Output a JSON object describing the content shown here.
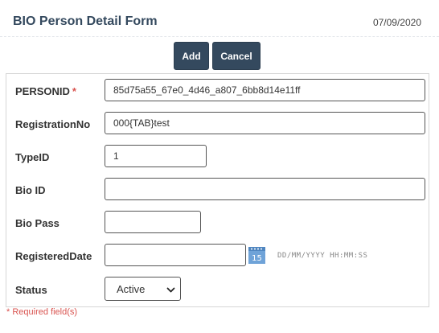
{
  "header": {
    "title": "BIO Person Detail Form",
    "date": "07/09/2020"
  },
  "toolbar": {
    "add_label": "Add",
    "cancel_label": "Cancel"
  },
  "form": {
    "personid": {
      "label": "PERSONID",
      "required_mark": "*",
      "value": "85d75a55_67e0_4d46_a807_6bb8d14e11ff"
    },
    "registration_no": {
      "label": "RegistrationNo",
      "value": "000{TAB}test"
    },
    "type_id": {
      "label": "TypeID",
      "value": "1"
    },
    "bio_id": {
      "label": "Bio ID",
      "value": ""
    },
    "bio_pass": {
      "label": "Bio Pass",
      "value": ""
    },
    "registered_date": {
      "label": "RegisteredDate",
      "value": "",
      "format_hint": "DD/MM/YYYY HH:MM:SS",
      "calendar_icon": "calendar-icon",
      "calendar_day": "15"
    },
    "status": {
      "label": "Status",
      "selected": "Active"
    }
  },
  "footer": {
    "required_note": "* Required field(s)"
  },
  "colors": {
    "primary": "#34495e",
    "required": "#d9534f",
    "calendar": "#6fa3d8"
  }
}
